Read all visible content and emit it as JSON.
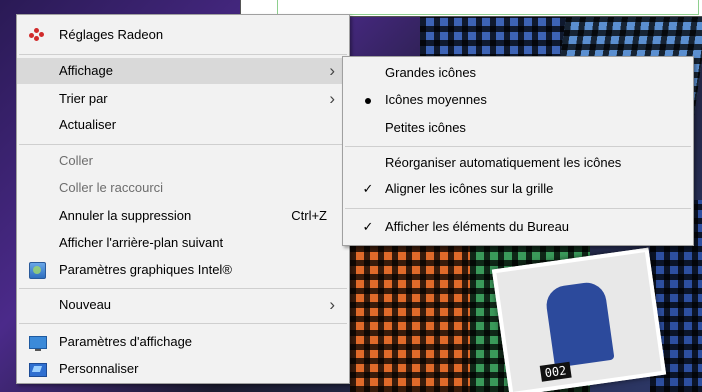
{
  "context_menu": {
    "items": [
      {
        "label": "Réglages Radeon",
        "icon": "radeon-icon"
      },
      {
        "label": "Affichage",
        "submenu": true
      },
      {
        "label": "Trier par",
        "submenu": true
      },
      {
        "label": "Actualiser"
      },
      {
        "label": "Coller",
        "disabled": true
      },
      {
        "label": "Coller le raccourci",
        "disabled": true
      },
      {
        "label": "Annuler la suppression",
        "shortcut": "Ctrl+Z"
      },
      {
        "label": "Afficher l'arrière-plan suivant"
      },
      {
        "label": "Paramètres graphiques Intel®",
        "icon": "intel-graphics-icon"
      },
      {
        "label": "Nouveau",
        "submenu": true
      },
      {
        "label": "Paramètres d'affichage",
        "icon": "display-settings-icon"
      },
      {
        "label": "Personnaliser",
        "icon": "personalize-icon"
      }
    ]
  },
  "view_submenu": {
    "items": [
      {
        "label": "Grandes icônes"
      },
      {
        "label": "Icônes moyennes",
        "selected": true
      },
      {
        "label": "Petites icônes"
      },
      {
        "label": "Réorganiser automatiquement les icônes"
      },
      {
        "label": "Aligner les icônes sur la grille",
        "checked": true
      },
      {
        "label": "Afficher les éléments du Bureau",
        "checked": true
      }
    ]
  },
  "wallpaper": {
    "scoreboard_text": "002"
  }
}
